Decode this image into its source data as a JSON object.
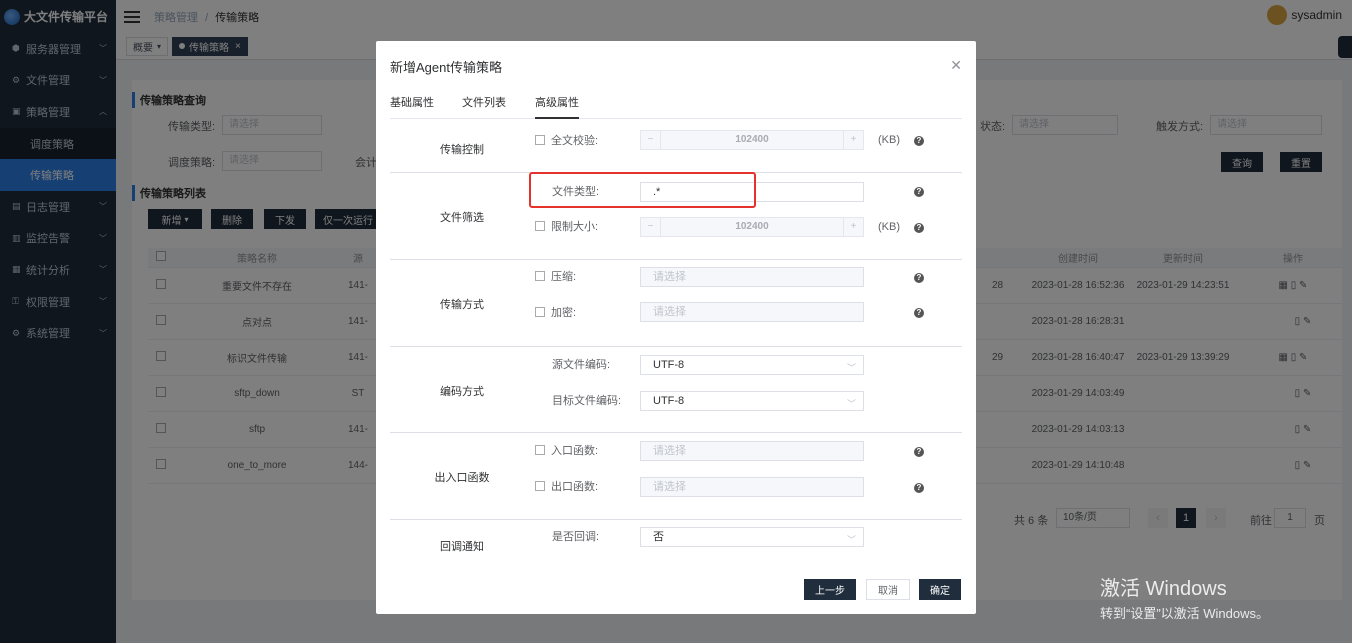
{
  "app": {
    "title": "大文件传输平台",
    "user": "sysadmin"
  },
  "sidebar": {
    "items": [
      {
        "label": "服务器管理",
        "icon": "server-icon"
      },
      {
        "label": "文件管理",
        "icon": "file-icon"
      },
      {
        "label": "策略管理",
        "icon": "policy-icon"
      },
      {
        "label": "调度策略",
        "icon": ""
      },
      {
        "label": "传输策略",
        "icon": ""
      },
      {
        "label": "日志管理",
        "icon": "log-icon"
      },
      {
        "label": "监控告警",
        "icon": "monitor-icon"
      },
      {
        "label": "统计分析",
        "icon": "stats-icon"
      },
      {
        "label": "权限管理",
        "icon": "permission-icon"
      },
      {
        "label": "系统管理",
        "icon": "system-icon"
      }
    ]
  },
  "breadcrumb": {
    "parent": "策略管理",
    "sep": "/",
    "current": "传输策略"
  },
  "tags": {
    "overview": "概要",
    "active": "传输策略"
  },
  "background": {
    "query_title": "传输策略查询",
    "list_title": "传输策略列表",
    "filter": {
      "transfer_type_label": "传输类型:",
      "schedule_label": "调度策略:",
      "partial_label": "会计",
      "status_label": "状态:",
      "trigger_label": "触发方式:",
      "placeholder": "请选择"
    },
    "buttons": {
      "query": "查询",
      "reset": "重置",
      "add": "新增",
      "delete": "删除",
      "issue": "下发",
      "run_once": "仅一次运行"
    },
    "table": {
      "headers": {
        "name": "策略名称",
        "source": "源",
        "created": "创建时间",
        "updated": "更新时间",
        "actions": "操作"
      },
      "rows": [
        {
          "name": "重要文件不存在",
          "source": "141-",
          "partial": "28",
          "created": "2023-01-28 16:52:36",
          "updated": "2023-01-29 14:23:51"
        },
        {
          "name": "点对点",
          "source": "141-",
          "partial": "",
          "created": "2023-01-28 16:28:31",
          "updated": ""
        },
        {
          "name": "标识文件传输",
          "source": "141-",
          "partial": "29",
          "created": "2023-01-28 16:40:47",
          "updated": "2023-01-29 13:39:29"
        },
        {
          "name": "sftp_down",
          "source": "ST",
          "partial": "",
          "created": "2023-01-29 14:03:49",
          "updated": ""
        },
        {
          "name": "sftp",
          "source": "141-",
          "partial": "",
          "created": "2023-01-29 14:03:13",
          "updated": ""
        },
        {
          "name": "one_to_more",
          "source": "144-",
          "partial": "",
          "created": "2023-01-29 14:10:48",
          "updated": ""
        }
      ]
    },
    "pager": {
      "total": "共 6 条",
      "size": "10条/页",
      "page": "1",
      "goto": "前往",
      "goto_value": "1",
      "suffix": "页"
    }
  },
  "dialog": {
    "title": "新增Agent传输策略",
    "tabs": [
      "基础属性",
      "文件列表",
      "高级属性"
    ],
    "groups": {
      "transfer_control": {
        "label": "传输控制",
        "full_check": "全文校验:",
        "full_check_value": "102400",
        "unit": "(KB)"
      },
      "file_filter": {
        "label": "文件筛选",
        "file_type": "文件类型:",
        "file_type_value": ".*",
        "size_limit": "限制大小:",
        "size_limit_value": "102400",
        "unit": "(KB)"
      },
      "transfer_mode": {
        "label": "传输方式",
        "compress": "压缩:",
        "encrypt": "加密:",
        "placeholder": "请选择"
      },
      "encoding": {
        "label": "编码方式",
        "source": "源文件编码:",
        "source_value": "UTF-8",
        "target": "目标文件编码:",
        "target_value": "UTF-8"
      },
      "io_func": {
        "label": "出入口函数",
        "entry": "入口函数:",
        "exit": "出口函数:",
        "placeholder": "请选择"
      },
      "callback": {
        "label": "回调通知",
        "question": "是否回调:",
        "value": "否"
      }
    },
    "footer": {
      "prev": "上一步",
      "cancel": "取消",
      "confirm": "确定"
    }
  },
  "watermark": {
    "line1": "激活 Windows",
    "line2": "转到“设置”以激活 Windows。"
  }
}
